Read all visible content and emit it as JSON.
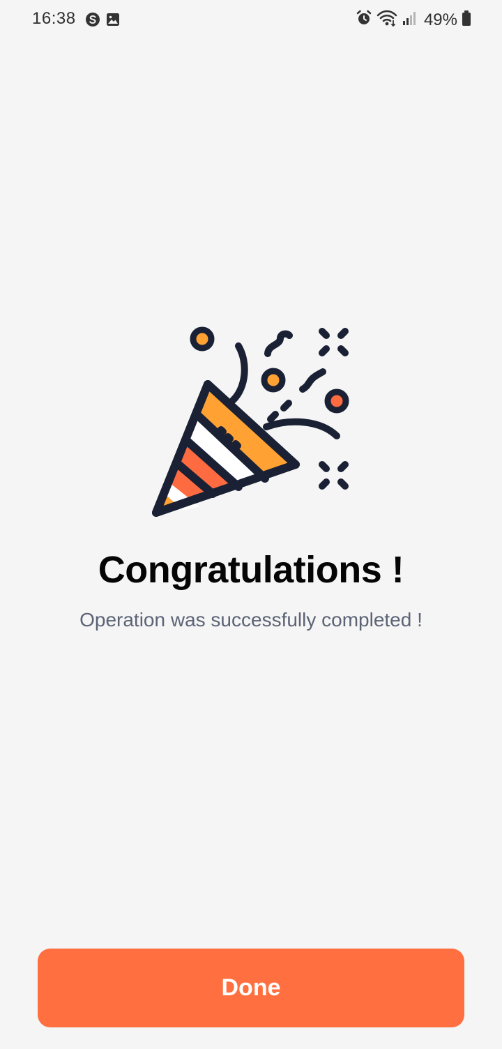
{
  "status_bar": {
    "time": "16:38",
    "battery": "49%",
    "icons": [
      "s-circle-icon",
      "image-icon",
      "alarm-icon",
      "wifi-icon",
      "signal-icon",
      "battery-icon"
    ]
  },
  "illustration": {
    "icon": "party-popper-icon",
    "colors": {
      "outline": "#1b2134",
      "orange": "#ffa233",
      "coral": "#ff6b40",
      "white": "#ffffff"
    }
  },
  "content": {
    "title": "Congratulations !",
    "subtitle": "Operation was successfully completed !"
  },
  "actions": {
    "done_label": "Done",
    "done_color": "#ff6f3f"
  }
}
